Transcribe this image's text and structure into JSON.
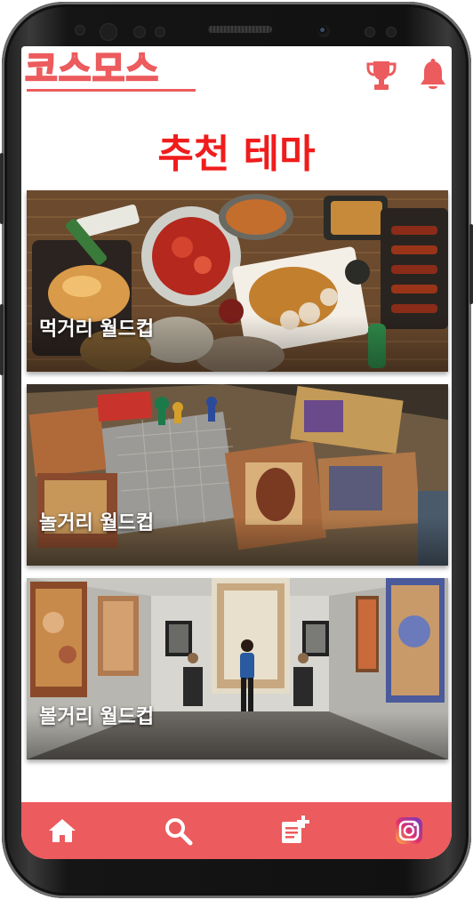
{
  "app": {
    "logo_text": "코스모스"
  },
  "header": {
    "icons": [
      "trophy-icon",
      "bell-icon"
    ]
  },
  "section": {
    "title": "추천 테마"
  },
  "themes": [
    {
      "label": "먹거리 월드컵",
      "image": "food-photo"
    },
    {
      "label": "놀거리 월드컵",
      "image": "board-game-photo"
    },
    {
      "label": "볼거리 월드컵",
      "image": "art-gallery-photo"
    }
  ],
  "nav": {
    "items": [
      "home-icon",
      "search-icon",
      "new-post-icon",
      "instagram-icon"
    ]
  },
  "colors": {
    "accent": "#ec5b5d",
    "title": "#f01c1c"
  }
}
